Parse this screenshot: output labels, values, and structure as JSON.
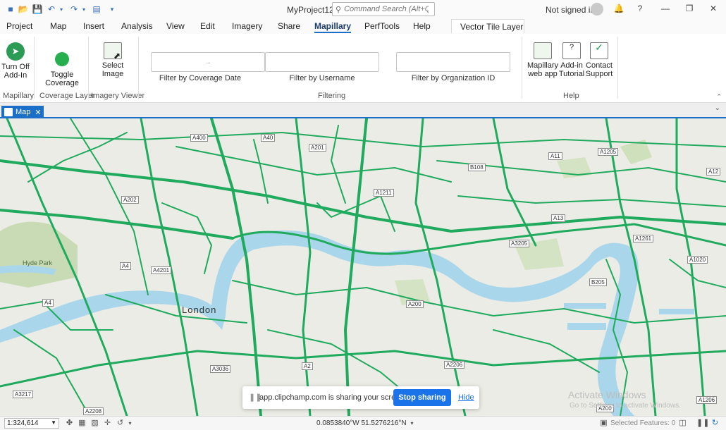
{
  "window": {
    "title": "MyProject12",
    "signed_in": "Not signed in",
    "command_search_placeholder": "Command Search (Alt+Q)"
  },
  "menu_tabs": [
    "Project",
    "Map",
    "Insert",
    "Analysis",
    "View",
    "Edit",
    "Imagery",
    "Share",
    "Mapillary",
    "PerfTools",
    "Help"
  ],
  "active_tab": "Mapillary",
  "contextual_tab": "Vector Tile Layer",
  "ribbon": {
    "mapillary": {
      "turn_off": "Turn Off\nAdd-In",
      "group": "Mapillary"
    },
    "coverage": {
      "toggle": "Toggle\nCoverage",
      "group": "Coverage Layer"
    },
    "imagery": {
      "select_image": "Select\nImage",
      "group": "Imagery Viewer"
    },
    "filtering": {
      "group": "Filtering",
      "coverage_date_label": "Filter by Coverage Date",
      "coverage_date_value": "→",
      "username_label": "Filter by Username",
      "org_label": "Filter by Organization ID"
    },
    "help": {
      "group": "Help",
      "web_app": "Mapillary\nweb app",
      "tutorial": "Add-in\nTutorial",
      "support": "Contact\nSupport"
    }
  },
  "map_tab": {
    "label": "Map"
  },
  "map": {
    "places": [
      {
        "text": "London"
      },
      {
        "text": "Hyde Park"
      }
    ],
    "road_labels": [
      "A400",
      "A40",
      "A201",
      "A11",
      "A1205",
      "A12",
      "B108",
      "A1211",
      "A13",
      "A13",
      "A1261",
      "A1020",
      "B205",
      "A200",
      "A2206",
      "A3036",
      "A3217",
      "A3205",
      "A4",
      "A4",
      "A4201",
      "A202",
      "A2",
      "A1206",
      "A2208",
      "A200"
    ],
    "colors": {
      "coverage": "#1faa5d",
      "water": "#a9d6ea",
      "park": "#c9dbb4",
      "land": "#ecece6"
    }
  },
  "share_bar": {
    "text": "app.clipchamp.com is sharing your screen.",
    "stop": "Stop sharing",
    "hide": "Hide"
  },
  "watermark": {
    "line1": "Activate Windows",
    "line2": "Go to Settings to activate Windows."
  },
  "status": {
    "scale": "1:324,614",
    "coordinates": "0.0853840°W 51.5276216°N",
    "selected_features": "Selected Features: 0"
  }
}
